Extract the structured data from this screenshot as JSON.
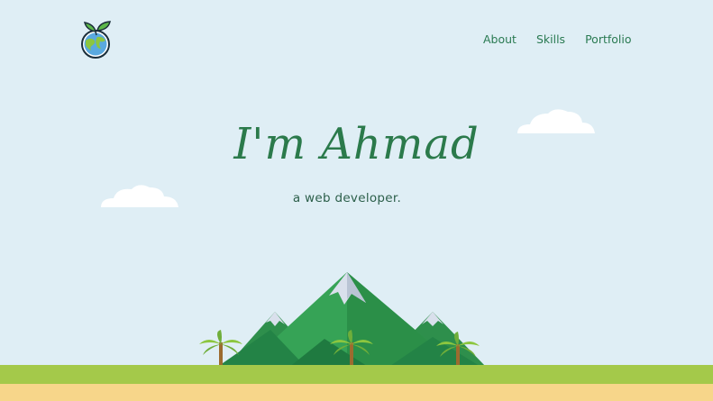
{
  "header": {
    "logo_icon": "globe-with-leaves-icon",
    "nav": [
      {
        "label": "About"
      },
      {
        "label": "Skills"
      },
      {
        "label": "Portfolio"
      }
    ]
  },
  "hero": {
    "title": "I'm Ahmad",
    "subtitle": "a web developer."
  },
  "colors": {
    "background": "#dfeef5",
    "accent": "#2b7a4b",
    "grass": "#a4c94a",
    "sand": "#f7d68a",
    "mountain": "#2e9a4f",
    "snow": "#d9e0ec"
  }
}
